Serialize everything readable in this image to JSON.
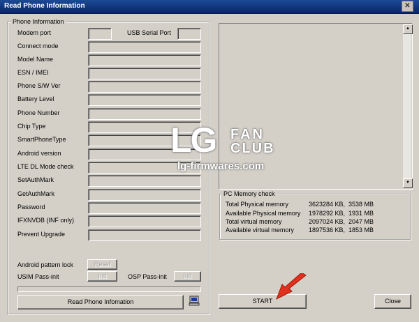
{
  "window": {
    "title": "Read Phone Information",
    "close_glyph": "✕"
  },
  "phone_info": {
    "legend": "Phone Information",
    "modem_port_label": "Modem port",
    "usb_serial_port_label": "USB Serial Port",
    "fields": [
      {
        "label": "Connect mode",
        "value": ""
      },
      {
        "label": "Model Name",
        "value": ""
      },
      {
        "label": "ESN / IMEI",
        "value": ""
      },
      {
        "label": "Phone S/W Ver",
        "value": ""
      },
      {
        "label": "Battery Level",
        "value": ""
      },
      {
        "label": "Phone Number",
        "value": ""
      },
      {
        "label": "Chip Type",
        "value": ""
      },
      {
        "label": "SmartPhoneType",
        "value": ""
      },
      {
        "label": "Android version",
        "value": ""
      },
      {
        "label": "LTE DL Mode check",
        "value": ""
      },
      {
        "label": "SetAuthMark",
        "value": ""
      },
      {
        "label": "GetAuthMark",
        "value": ""
      },
      {
        "label": "Password",
        "value": ""
      },
      {
        "label": "IFXNVDB (INF only)",
        "value": ""
      },
      {
        "label": "Prevent Upgrade",
        "value": ""
      }
    ],
    "android_pattern_lock_label": "Android pattern lock",
    "reset_button": "Reset",
    "usim_pass_init_label": "USIM Pass-init",
    "usim_init_button": "Init",
    "osp_pass_init_label": "OSP Pass-init",
    "osp_init_button": "Init"
  },
  "read_button": "Read Phone Infomation",
  "pc_memory": {
    "legend": "PC Memory check",
    "rows": [
      {
        "label": "Total Physical memory",
        "kb": "3623284 KB,",
        "mb": "3538 MB"
      },
      {
        "label": "Available Physical memory",
        "kb": "1978292 KB,",
        "mb": "1931 MB"
      },
      {
        "label": "Total virtual memory",
        "kb": "2097024 KB,",
        "mb": "2047 MB"
      },
      {
        "label": "Available virtual memory",
        "kb": "1897536 KB,",
        "mb": "1853 MB"
      }
    ]
  },
  "start_button": "START",
  "close_button": "Close",
  "watermark": {
    "logo": "LG",
    "fan": "FAN",
    "club": "CLUB",
    "site": "lg-firmwares.com"
  },
  "icons": {
    "computer": "computer-icon",
    "arrow": "red-arrow-icon"
  },
  "colors": {
    "titlebar": "#0a246a",
    "arrow": "#e0301e"
  }
}
